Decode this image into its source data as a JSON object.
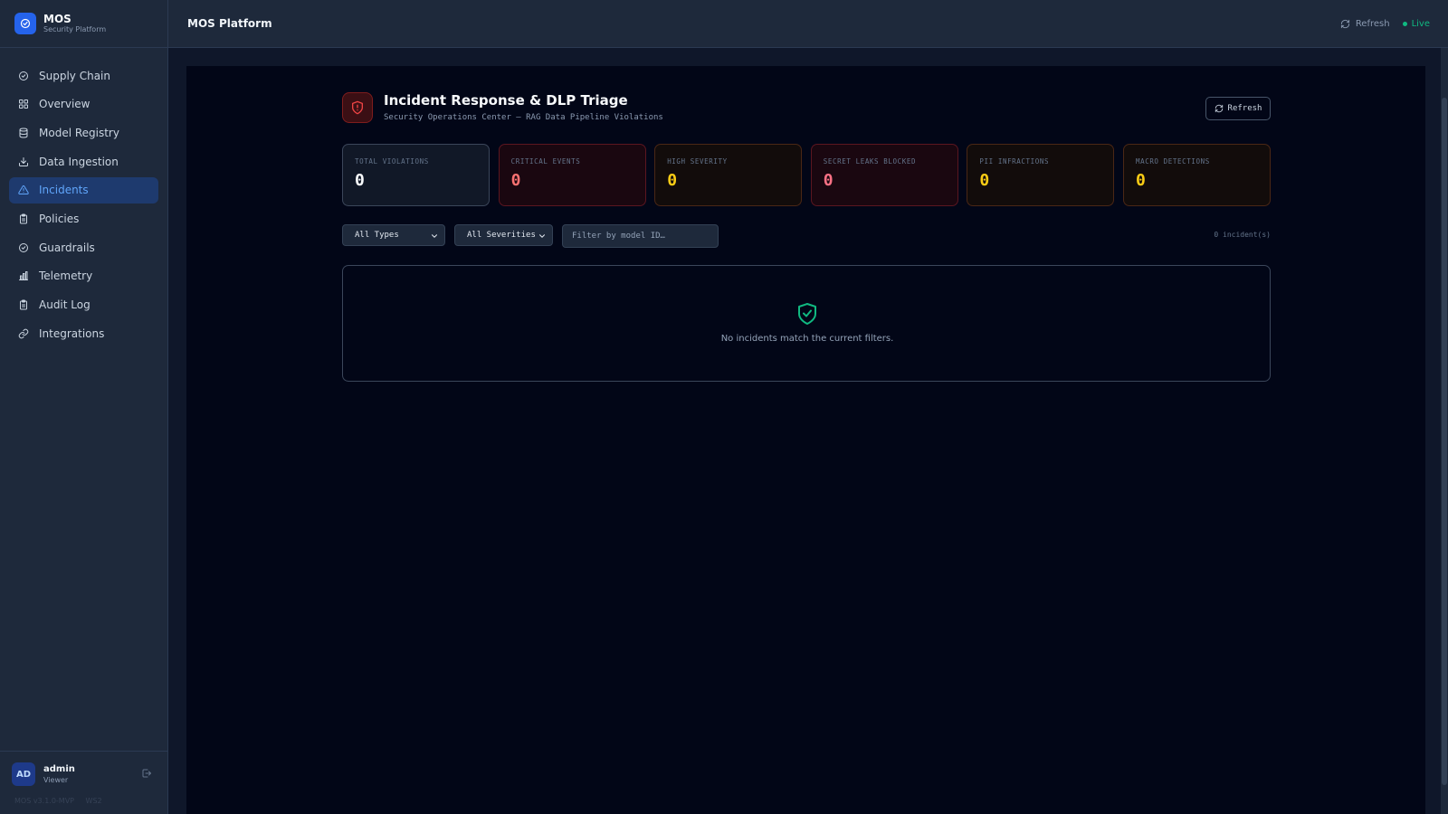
{
  "brand": {
    "name": "MOS",
    "subtitle": "Security Platform"
  },
  "sidebar": {
    "items": [
      {
        "label": "Supply Chain",
        "icon": "shield-check-icon"
      },
      {
        "label": "Overview",
        "icon": "grid-icon"
      },
      {
        "label": "Model Registry",
        "icon": "database-icon"
      },
      {
        "label": "Data Ingestion",
        "icon": "download-icon"
      },
      {
        "label": "Incidents",
        "icon": "alert-triangle-icon",
        "active": true
      },
      {
        "label": "Policies",
        "icon": "clipboard-icon"
      },
      {
        "label": "Guardrails",
        "icon": "shield-check-icon"
      },
      {
        "label": "Telemetry",
        "icon": "bar-chart-icon"
      },
      {
        "label": "Audit Log",
        "icon": "clipboard-icon"
      },
      {
        "label": "Integrations",
        "icon": "link-icon"
      }
    ]
  },
  "user": {
    "initials": "AD",
    "name": "admin",
    "role": "Viewer"
  },
  "footer": {
    "version": "MOS v3.1.0-MVP",
    "ws": "WS2"
  },
  "header": {
    "title": "MOS Platform",
    "refresh_label": "Refresh",
    "live_label": "Live"
  },
  "page": {
    "title": "Incident Response & DLP Triage",
    "subtitle": "Security Operations Center — RAG Data Pipeline Violations",
    "refresh_label": "Refresh"
  },
  "stats": [
    {
      "label": "Total Violations",
      "value": "0",
      "tone": "neutral"
    },
    {
      "label": "Critical Events",
      "value": "0",
      "tone": "red"
    },
    {
      "label": "High Severity",
      "value": "0",
      "tone": "amber"
    },
    {
      "label": "Secret Leaks Blocked",
      "value": "0",
      "tone": "rose"
    },
    {
      "label": "PII Infractions",
      "value": "0",
      "tone": "amber"
    },
    {
      "label": "Macro Detections",
      "value": "0",
      "tone": "amber"
    }
  ],
  "filters": {
    "type_selected": "All Types",
    "severity_selected": "All Severities",
    "model_placeholder": "Filter by model ID…",
    "count_text": "0 incident(s)"
  },
  "empty_state": {
    "message": "No incidents match the current filters."
  },
  "colors": {
    "accent": "#2563eb",
    "danger": "#ef4444",
    "success": "#10b981",
    "warning": "#facc15"
  }
}
